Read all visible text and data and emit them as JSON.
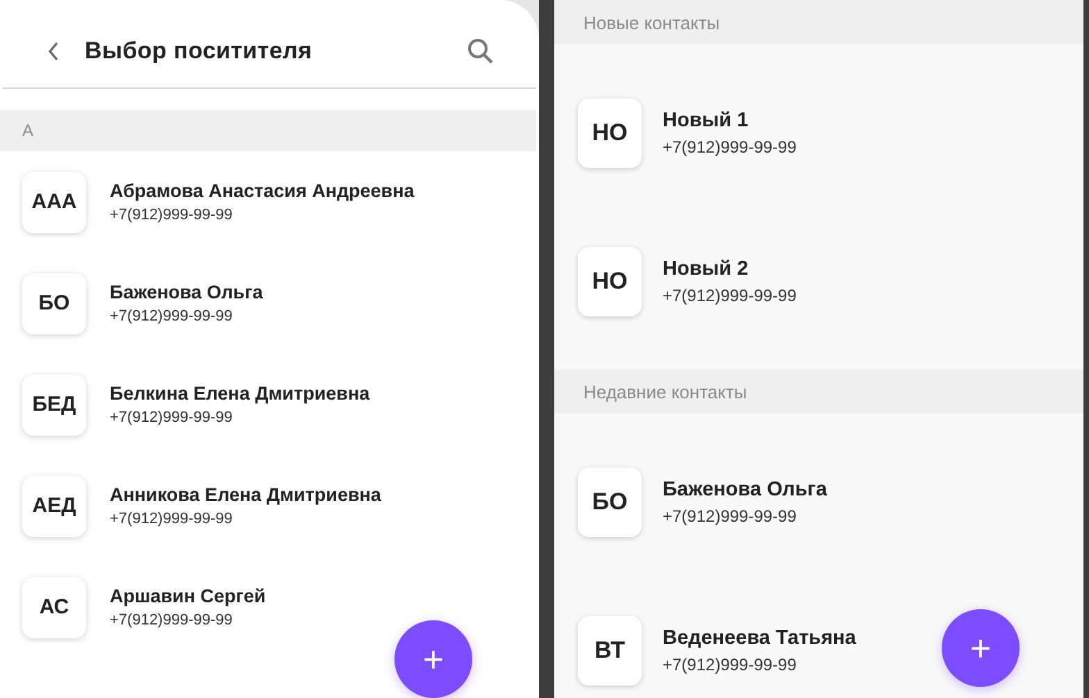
{
  "left_screen": {
    "header": {
      "title": "Выбор поситителя"
    },
    "sections": [
      {
        "title": "А",
        "contacts": [
          {
            "initials": "ААА",
            "name": "Абрамова Анастасия Андреевна",
            "phone": "+7(912)999-99-99"
          },
          {
            "initials": "БО",
            "name": "Баженова Ольга",
            "phone": "+7(912)999-99-99"
          },
          {
            "initials": "БЕД",
            "name": "Белкина Елена Дмитриевна",
            "phone": "+7(912)999-99-99"
          },
          {
            "initials": "АЕД",
            "name": "Анникова Елена Дмитриевна",
            "phone": "+7(912)999-99-99"
          },
          {
            "initials": "АС",
            "name": "Аршавин Сергей",
            "phone": "+7(912)999-99-99"
          }
        ]
      }
    ],
    "fab": "+"
  },
  "right_screen": {
    "sections": [
      {
        "title": "Новые контакты",
        "contacts": [
          {
            "initials": "НО",
            "name": "Новый 1",
            "phone": "+7(912)999-99-99"
          },
          {
            "initials": "НО",
            "name": "Новый 2",
            "phone": "+7(912)999-99-99"
          }
        ]
      },
      {
        "title": "Недавние контакты",
        "contacts": [
          {
            "initials": "БО",
            "name": "Баженова Ольга",
            "phone": "+7(912)999-99-99"
          },
          {
            "initials": "ВТ",
            "name": "Веденеева Татьяна",
            "phone": "+7(912)999-99-99"
          }
        ]
      }
    ],
    "fab": "+"
  }
}
